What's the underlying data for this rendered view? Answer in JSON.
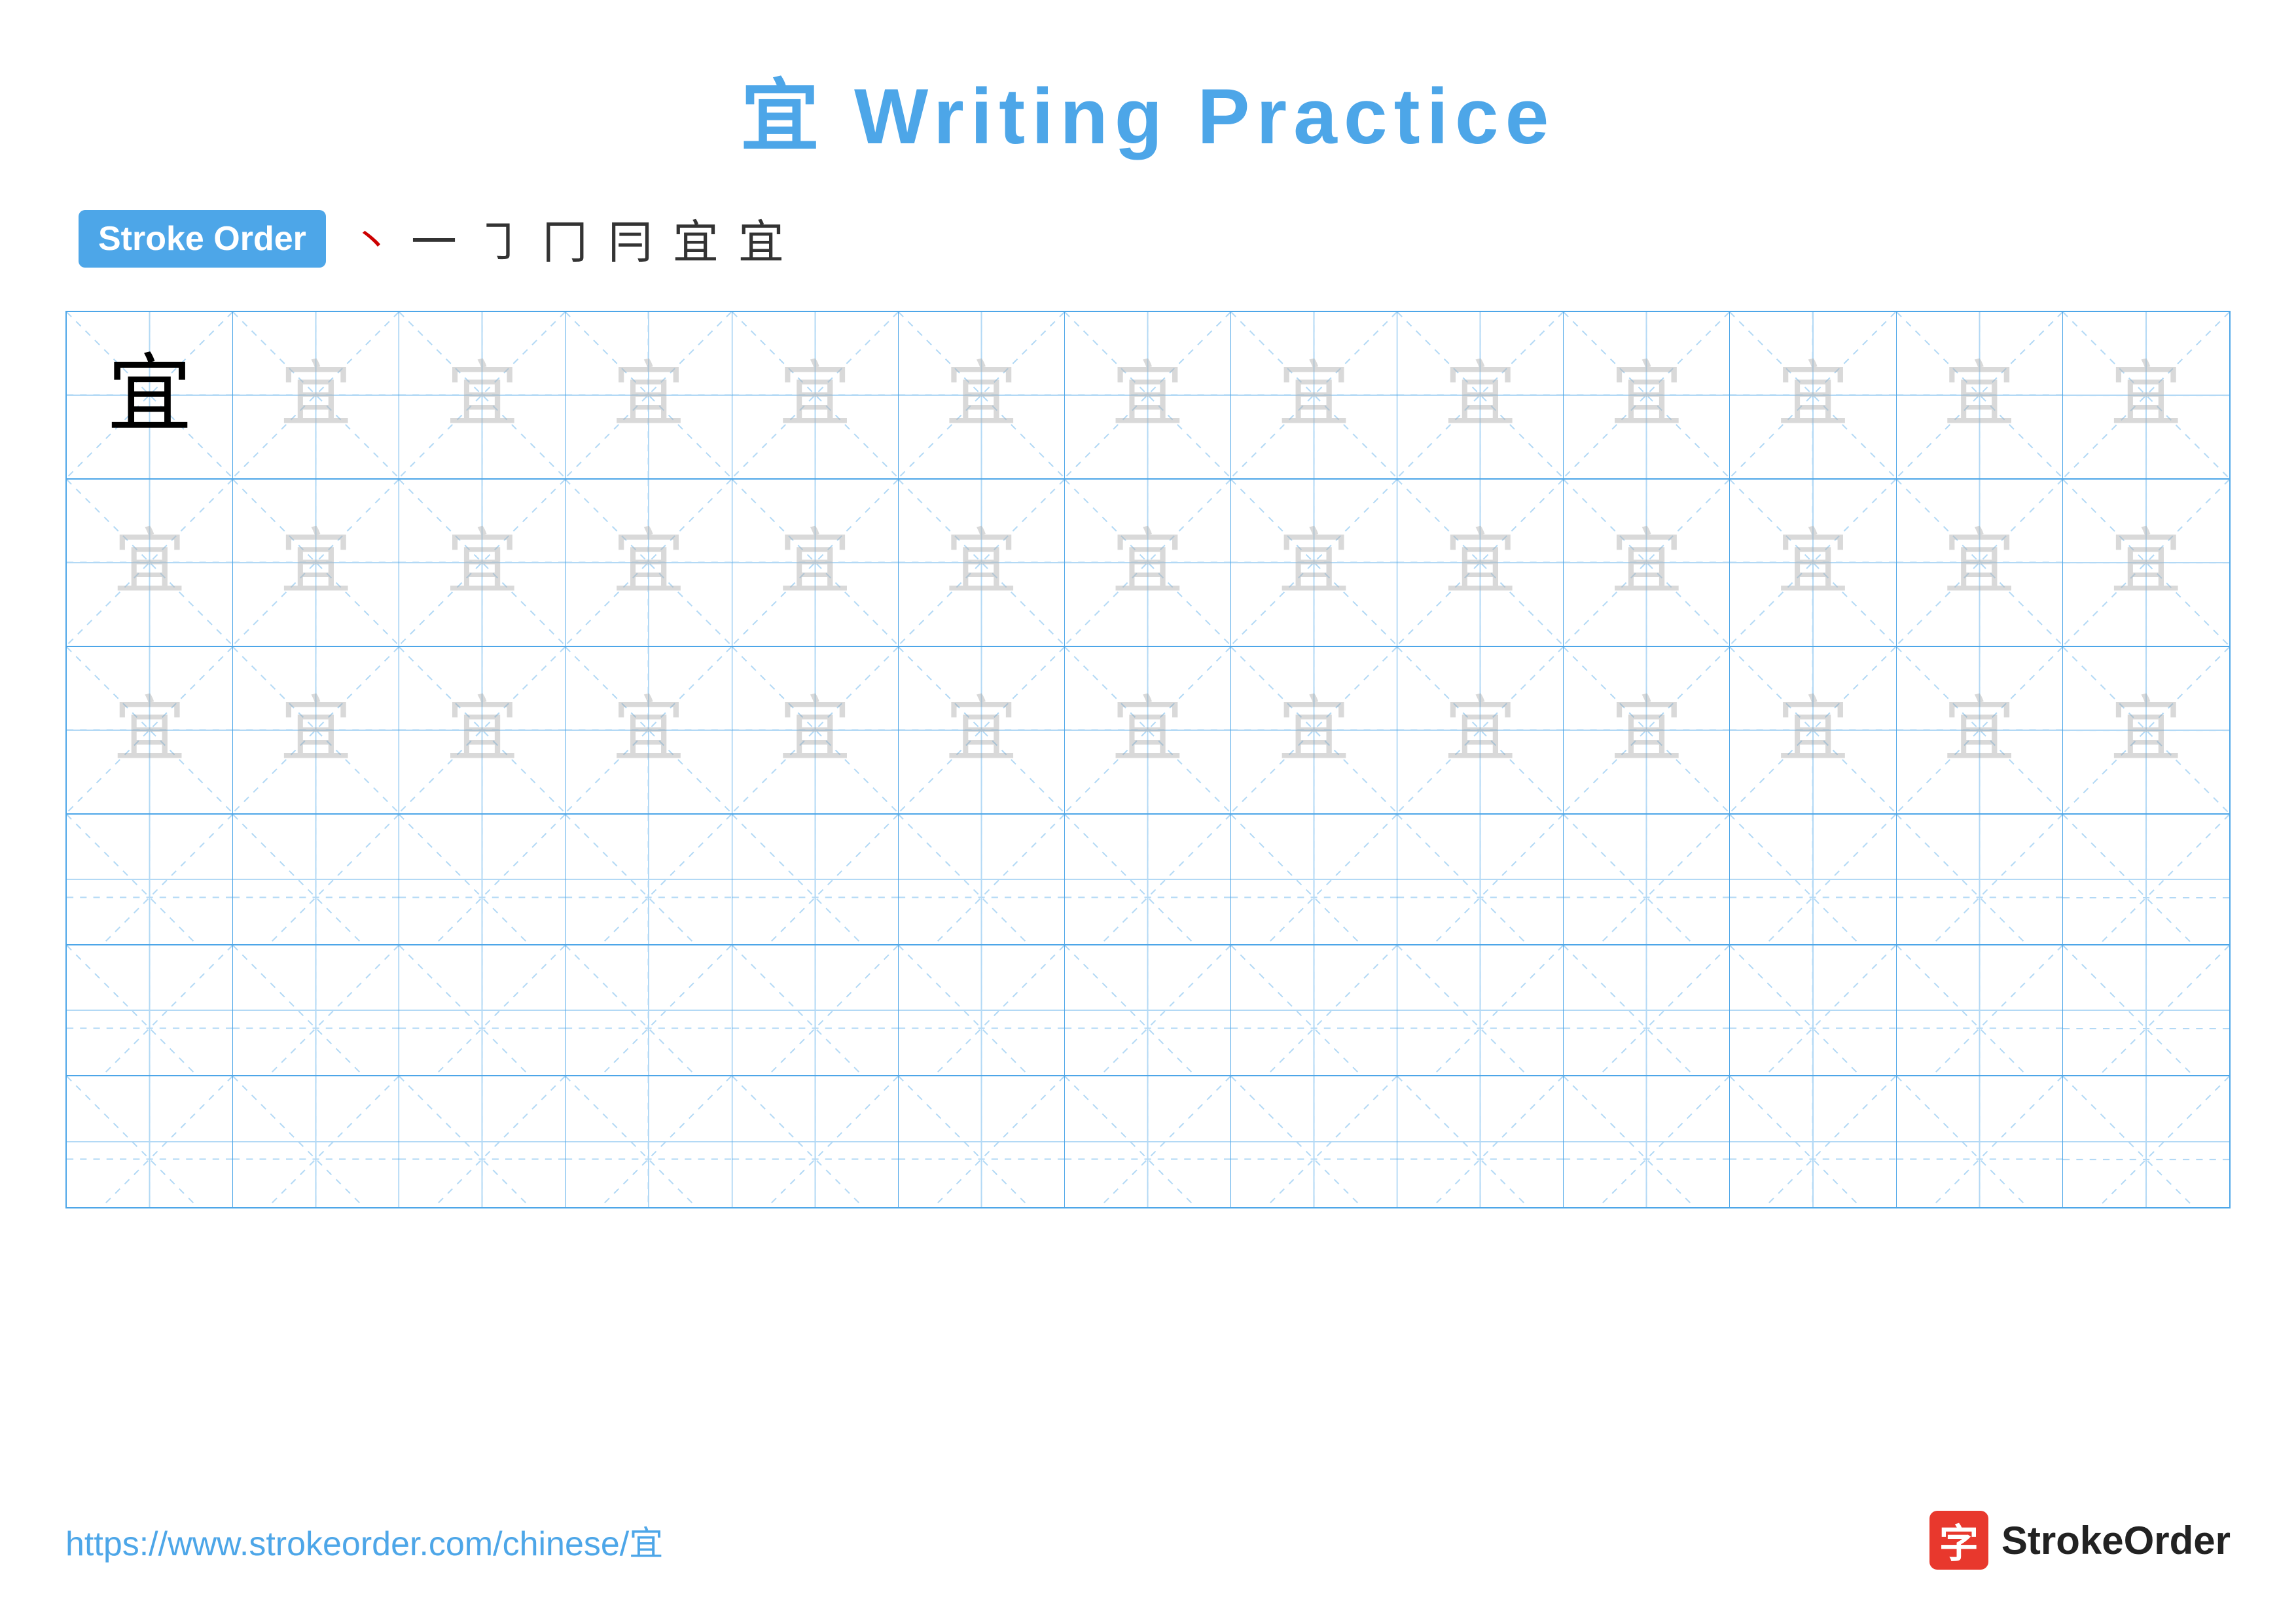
{
  "title": {
    "char": "宜",
    "text": " Writing Practice",
    "full": "宜 Writing Practice"
  },
  "stroke_order": {
    "badge_label": "Stroke Order",
    "strokes": [
      "丶",
      "一",
      "㇆",
      "冂",
      "冂",
      "冃",
      "宜"
    ]
  },
  "grid": {
    "rows": 6,
    "cols": 13,
    "row_data": [
      {
        "type": "practice",
        "first_solid": true
      },
      {
        "type": "practice",
        "first_solid": false
      },
      {
        "type": "practice",
        "first_solid": false
      },
      {
        "type": "empty"
      },
      {
        "type": "empty"
      },
      {
        "type": "empty"
      }
    ]
  },
  "footer": {
    "url": "https://www.strokeorder.com/chinese/宜",
    "logo_char": "字",
    "logo_name": "StrokeOrder"
  },
  "colors": {
    "blue": "#4da6e8",
    "red": "#cc0000",
    "light_grid_line": "#b3d9f5",
    "solid_grid_line": "#4da6e8"
  }
}
